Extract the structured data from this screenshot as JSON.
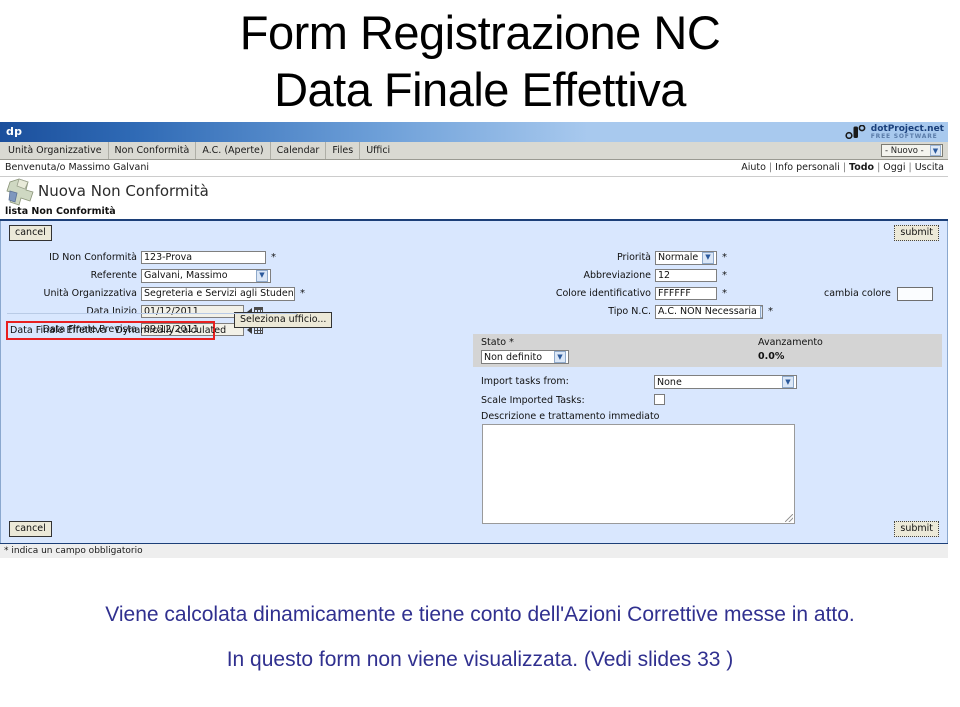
{
  "slide": {
    "title_line1": "Form Registrazione NC",
    "title_line2": "Data Finale Effettiva",
    "caption_line1": "Viene calcolata dinamicamente e tiene conto dell'Azioni Correttive messe in atto.",
    "caption_line2": "In questo form non viene visualizzata. (Vedi slides 33 )"
  },
  "app": {
    "logo_text": "dp",
    "brand_name": "dotProject.net",
    "brand_sub": "FREE SOFTWARE",
    "menu_items": [
      "Unità Organizzative",
      "Non Conformità",
      "A.C. (Aperte)",
      "Calendar",
      "Files",
      "Uffici"
    ],
    "new_select_value": "- Nuovo -",
    "welcome_text": "Benvenuta/o Massimo Galvani",
    "user_links": [
      "Aiuto",
      "Info personali",
      "Todo",
      "Oggi",
      "Uscita"
    ],
    "page_title": "Nuova Non Conformità",
    "breadcrumb": "lista Non Conformità"
  },
  "form": {
    "cancel_label": "cancel",
    "submit_label": "submit",
    "required_note": "* indica un campo obbligatorio",
    "required_marker": "*",
    "left_fields": [
      {
        "label": "ID Non Conformità",
        "value": "123-Prova",
        "type": "text",
        "required": true
      },
      {
        "label": "Referente",
        "value": "Galvani, Massimo",
        "type": "select",
        "required": false
      },
      {
        "label": "Unità Organizzativa",
        "value": "Segreteria e Servizi agli Studenti",
        "type": "select",
        "required": true
      },
      {
        "label": "Data Inizio",
        "value": "01/12/2011",
        "type": "date",
        "required": false
      },
      {
        "label": "Data Finale Prevista",
        "value": "09/12/2011",
        "type": "date",
        "required": false
      }
    ],
    "office_button_label": "Seleziona ufficio...",
    "highlighted_field": {
      "label": "Data Finale Effettiva",
      "value": "Dynamically calculated",
      "highlight_color": "#e82020"
    },
    "right_fields": [
      {
        "label": "Priorità",
        "value": "Normale",
        "type": "select",
        "required": true
      },
      {
        "label": "Abbreviazione",
        "value": "12",
        "type": "text",
        "required": true
      },
      {
        "label": "Colore identificativo",
        "value": "FFFFFF",
        "type": "text",
        "required": true
      },
      {
        "label": "Tipo N.C.",
        "value": "A.C. NON Necessaria",
        "type": "select",
        "required": true
      }
    ],
    "color_picker": {
      "label": "cambia colore",
      "swatch_color": "#ffffff"
    },
    "status_panel": {
      "state_label": "Stato *",
      "state_value": "Non definito",
      "progress_label": "Avanzamento",
      "progress_value": "0.0%"
    },
    "import_label": "Import tasks from:",
    "import_value": "None",
    "scale_label": "Scale Imported Tasks:",
    "scale_checked": false,
    "description_label": "Descrizione e trattamento immediato",
    "description_value": ""
  }
}
